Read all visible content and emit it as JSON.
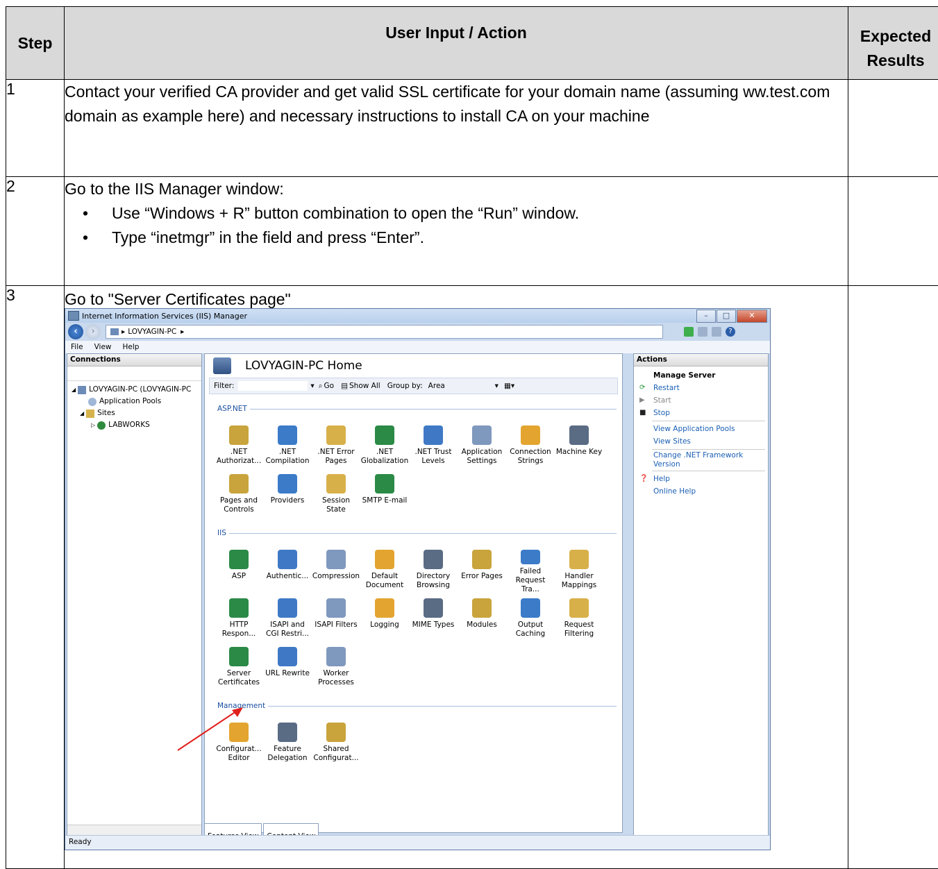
{
  "table": {
    "headers": [
      "Step",
      "User Input / Action",
      "Expected Results"
    ],
    "rows": [
      {
        "step": "1",
        "action": "Contact your verified CA provider and get valid SSL certificate for your domain name (assuming ww.test.com domain as example here) and necessary instructions to install CA on your machine",
        "expected": ""
      },
      {
        "step": "2",
        "action": "Go to the IIS Manager window:",
        "bullets": [
          "Use “Windows + R” button combination to open the “Run” window.",
          "Type “inetmgr” in the field and press “Enter”."
        ],
        "expected": ""
      },
      {
        "step": "3",
        "action": "Go to \"Server Certificates page\"",
        "expected": ""
      }
    ]
  },
  "iis": {
    "window_title": "Internet Information Services (IIS) Manager",
    "address": "LOVYAGIN-PC",
    "menu": [
      "File",
      "View",
      "Help"
    ],
    "connections": {
      "title": "Connections",
      "tree": [
        "LOVYAGIN-PC (LOVYAGIN-PC",
        "Application Pools",
        "Sites",
        "LABWORKS"
      ]
    },
    "home_title": "LOVYAGIN-PC Home",
    "filter": {
      "label": "Filter:",
      "go": "Go",
      "show_all": "Show All",
      "group_by": "Group by:",
      "group_value": "Area"
    },
    "sections": [
      {
        "name": "ASP.NET",
        "items": [
          ".NET Authorizat...",
          ".NET Compilation",
          ".NET Error Pages",
          ".NET Globalization",
          ".NET Trust Levels",
          "Application Settings",
          "Connection Strings",
          "Machine Key",
          "Pages and Controls",
          "Providers",
          "Session State",
          "SMTP E-mail"
        ]
      },
      {
        "name": "IIS",
        "items": [
          "ASP",
          "Authentic...",
          "Compression",
          "Default Document",
          "Directory Browsing",
          "Error Pages",
          "Failed Request Tra...",
          "Handler Mappings",
          "HTTP Respon...",
          "ISAPI and CGI Restri...",
          "ISAPI Filters",
          "Logging",
          "MIME Types",
          "Modules",
          "Output Caching",
          "Request Filtering",
          "Server Certificates",
          "URL Rewrite",
          "Worker Processes"
        ]
      },
      {
        "name": "Management",
        "items": [
          "Configurat... Editor",
          "Feature Delegation",
          "Shared Configurat..."
        ]
      }
    ],
    "tabs": [
      "Features View",
      "Content View"
    ],
    "actions": {
      "title": "Actions",
      "header": "Manage Server",
      "restart": "Restart",
      "start": "Start",
      "stop": "Stop",
      "view_pools": "View Application Pools",
      "view_sites": "View Sites",
      "change_net": "Change .NET Framework Version",
      "help": "Help",
      "online_help": "Online Help"
    },
    "status": "Ready"
  }
}
